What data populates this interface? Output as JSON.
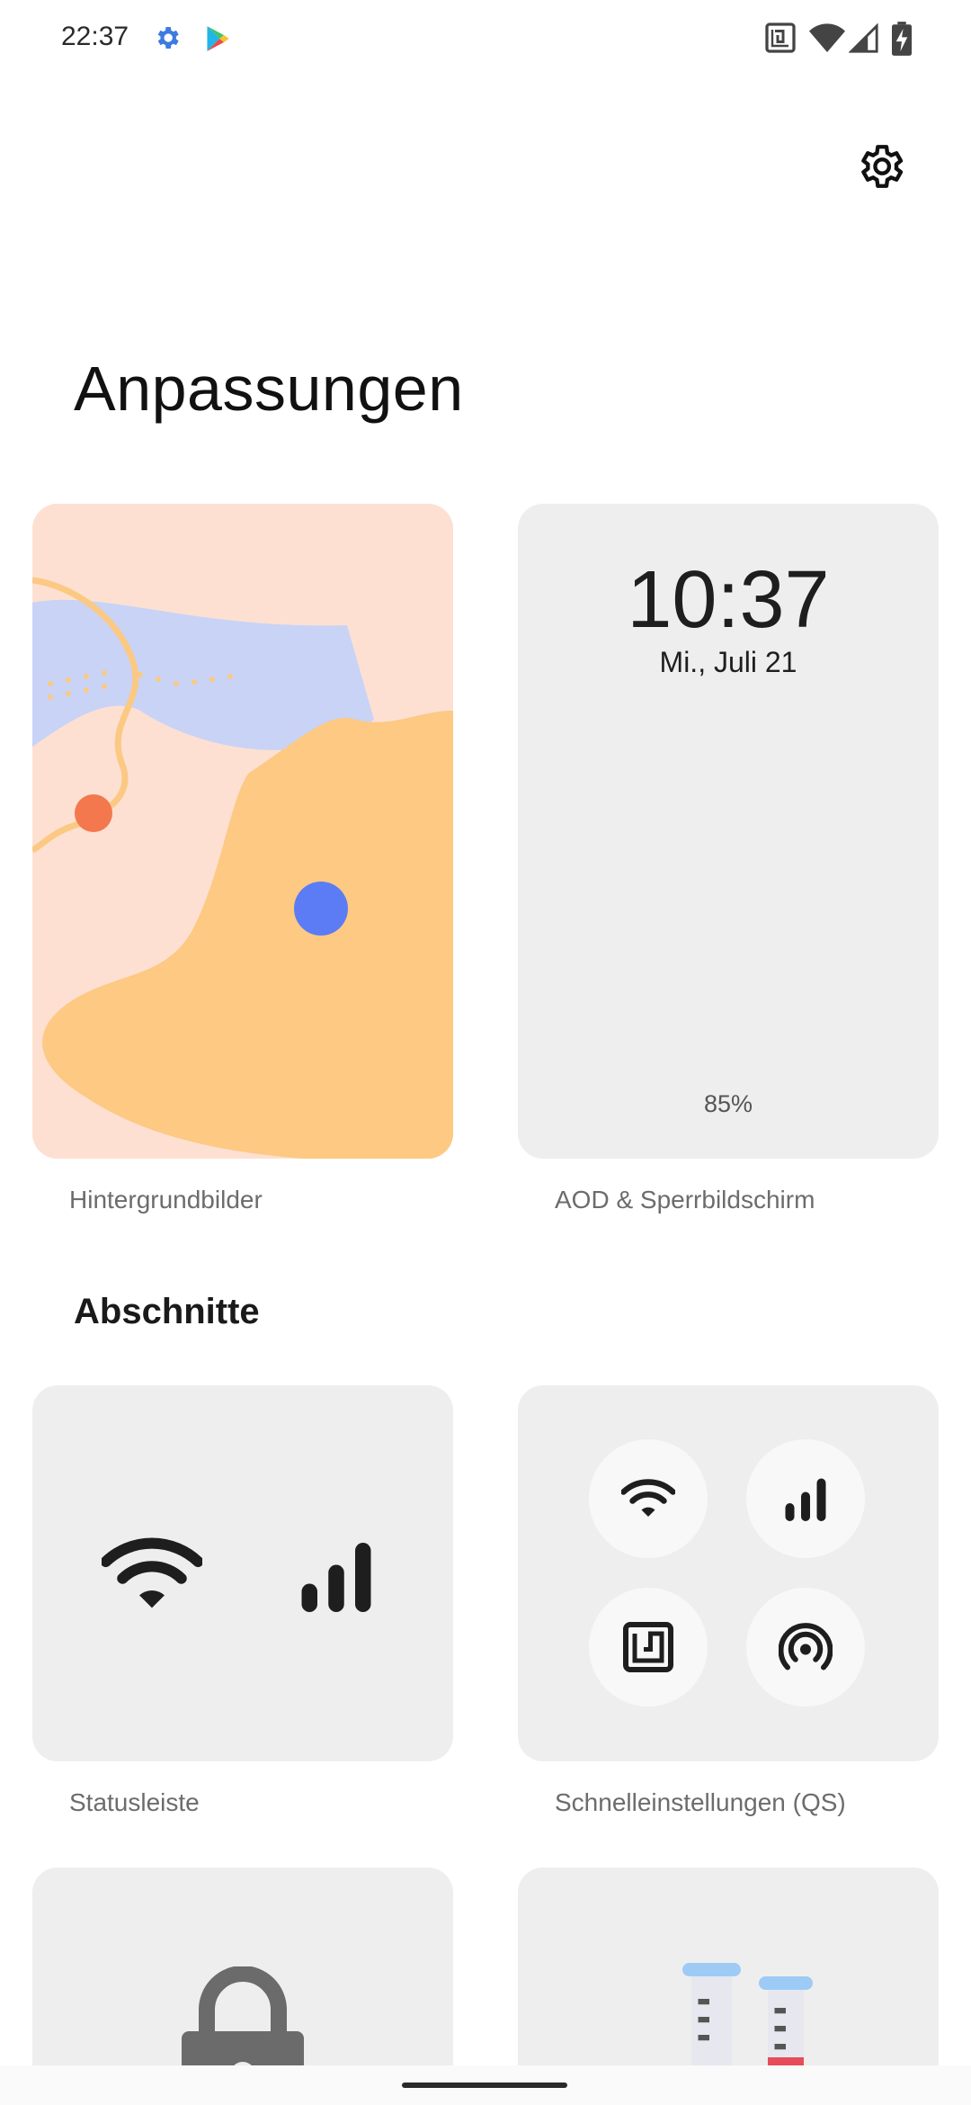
{
  "status_bar": {
    "time": "22:37",
    "icons": [
      "gear-icon",
      "play-store-icon",
      "nfc-icon",
      "wifi-icon",
      "signal-icon",
      "battery-icon"
    ]
  },
  "header": {
    "settings_icon": "gear-icon"
  },
  "page": {
    "title": "Anpassungen"
  },
  "cards_top": {
    "wallpaper": {
      "label": "Hintergrundbilder",
      "colors": {
        "background": "#fde0d2",
        "blue_band": "#c8d3f6",
        "orange_blob": "#fdc983",
        "dot_orange": "#f3784e",
        "dot_blue": "#5b7cf5"
      }
    },
    "aod": {
      "label": "AOD & Sperrbildschirm",
      "time": "10:37",
      "date": "Mi., Juli 21",
      "battery": "85%"
    }
  },
  "section": {
    "heading": "Abschnitte"
  },
  "cards_sections": {
    "statusbar": {
      "label": "Statusleiste",
      "icons": [
        "wifi-icon",
        "signal-icon"
      ]
    },
    "quick_settings": {
      "label": "Schnelleinstellungen (QS)",
      "icons": [
        "wifi-icon",
        "signal-icon",
        "nfc-icon",
        "hotspot-icon"
      ]
    },
    "lockscreen": {
      "icon": "lock-icon"
    },
    "lab": {
      "icon": "test-tubes-icon"
    }
  },
  "colors": {
    "card_bg": "#eeeeee",
    "label_text": "#6c6c6c"
  }
}
